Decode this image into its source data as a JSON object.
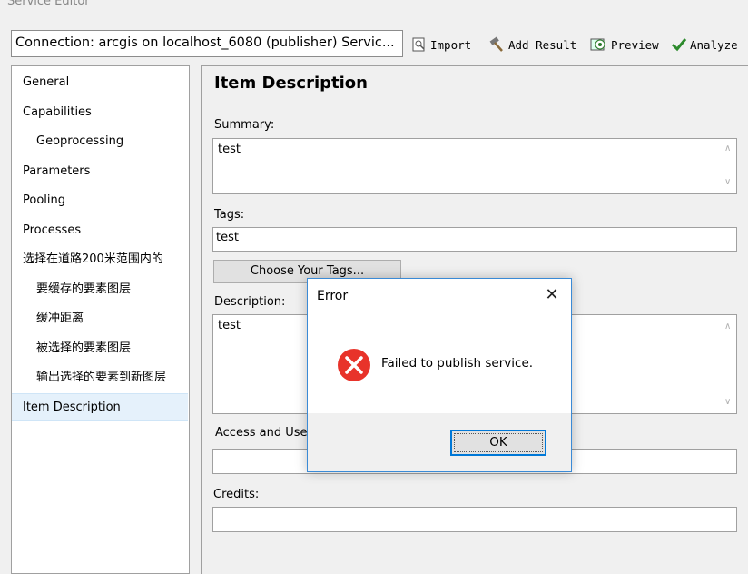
{
  "window": {
    "title": "Service Editor"
  },
  "toolbar": {
    "connection": "Connection: arcgis on localhost_6080 (publisher)   Servic...",
    "import_label": "Import",
    "add_result_label": "Add Result",
    "preview_label": "Preview",
    "analyze_label": "Analyze"
  },
  "sidebar": {
    "items": [
      {
        "label": "General",
        "indent": false
      },
      {
        "label": "Capabilities",
        "indent": false
      },
      {
        "label": "Geoprocessing",
        "indent": true
      },
      {
        "label": "Parameters",
        "indent": false
      },
      {
        "label": "Pooling",
        "indent": false
      },
      {
        "label": "Processes",
        "indent": false
      },
      {
        "label": "选择在道路200米范围内的",
        "indent": false
      },
      {
        "label": "要缓存的要素图层",
        "indent": true
      },
      {
        "label": "缓冲距离",
        "indent": true
      },
      {
        "label": "被选择的要素图层",
        "indent": true
      },
      {
        "label": "输出选择的要素到新图层",
        "indent": true
      },
      {
        "label": "Item Description",
        "indent": false,
        "selected": true
      }
    ]
  },
  "panel": {
    "title": "Item Description",
    "summary_label": "Summary:",
    "summary_value": "test",
    "tags_label": "Tags:",
    "tags_value": "test",
    "choose_tags_label": "Choose Your Tags...",
    "description_label": "Description:",
    "description_value": "test",
    "access_label": "Access and Use C",
    "access_value": "",
    "credits_label": "Credits:",
    "credits_value": ""
  },
  "dialog": {
    "title": "Error",
    "message": "Failed to publish service.",
    "ok_label": "OK",
    "icon": "error-icon",
    "error_color": "#e8332a"
  }
}
